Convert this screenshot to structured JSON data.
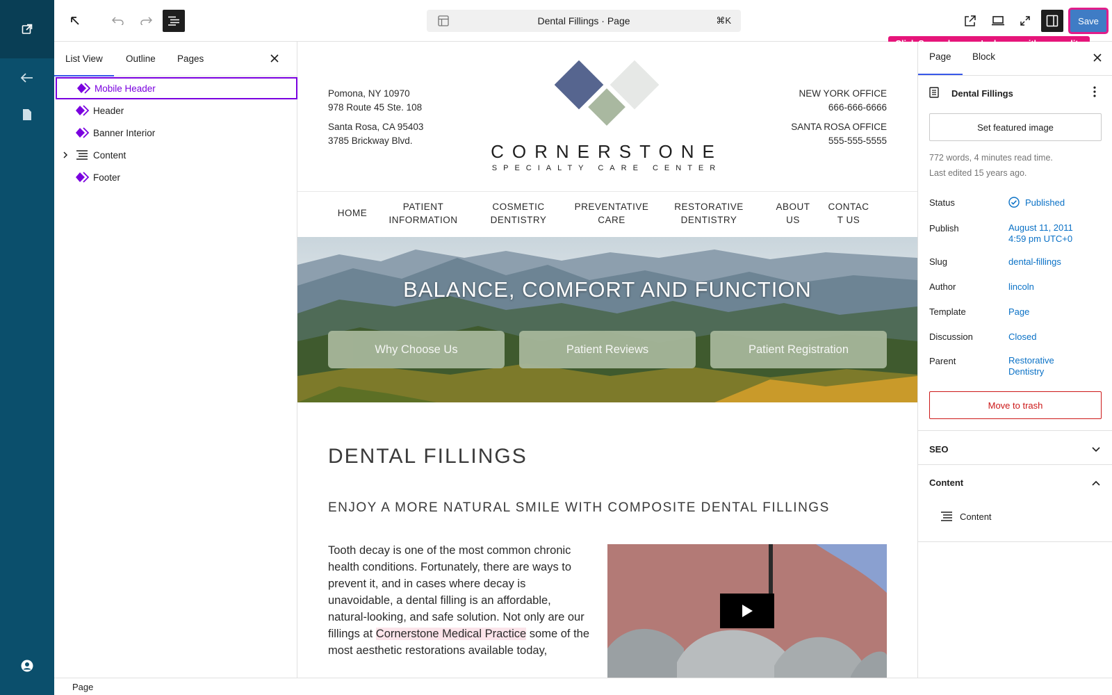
{
  "rail": {
    "icons": [
      "external-link-icon",
      "arrow-left-icon",
      "page-icon",
      "user-avatar-icon"
    ]
  },
  "topbar": {
    "document_title": "Dental Fillings · Page",
    "shortcut": "⌘K",
    "save_label": "Save",
    "tooltip": "Click Save when you're happy with your edits"
  },
  "listview": {
    "tabs": [
      "List View",
      "Outline",
      "Pages"
    ],
    "items": [
      {
        "label": "Mobile Header",
        "selected": true
      },
      {
        "label": "Header"
      },
      {
        "label": "Banner Interior"
      },
      {
        "label": "Content"
      },
      {
        "label": "Footer"
      }
    ]
  },
  "canvas": {
    "header_left": {
      "line1": "Pomona, NY 10970",
      "line2": "978 Route 45 Ste. 108",
      "line3": "Santa Rosa, CA 95403",
      "line4": "3785 Brickway Blvd."
    },
    "logo": {
      "name": "CORNERSTONE",
      "subtitle": "SPECIALTY CARE CENTER",
      "colors": {
        "dark": "#56658f",
        "light": "#e6e8e6",
        "green": "#a9b8a0"
      }
    },
    "header_right": {
      "line1": "NEW YORK OFFICE",
      "line2": "666-666-6666",
      "line3": "SANTA ROSA OFFICE",
      "line4": "555-555-5555"
    },
    "nav": [
      {
        "l1": "HOME",
        "l2": ""
      },
      {
        "l1": "PATIENT",
        "l2": "INFORMATION"
      },
      {
        "l1": "COSMETIC",
        "l2": "DENTISTRY"
      },
      {
        "l1": "PREVENTATIVE",
        "l2": "CARE"
      },
      {
        "l1": "RESTORATIVE",
        "l2": "DENTISTRY"
      },
      {
        "l1": "ABOUT",
        "l2": "US"
      },
      {
        "l1": "CONTAC",
        "l2": "T US"
      }
    ],
    "banner": {
      "title": "BALANCE, COMFORT AND FUNCTION",
      "buttons": [
        "Why Choose Us",
        "Patient Reviews",
        "Patient Registration"
      ]
    },
    "heading": "DENTAL FILLINGS",
    "subheading": "ENJOY A MORE NATURAL SMILE WITH COMPOSITE DENTAL FILLINGS",
    "body": {
      "before": "Tooth decay is one of the most common chronic health conditions. Fortunately, there are ways to prevent it, and in cases where decay is unavoidable, a dental filling is an affordable, natural-looking, and safe solution. Not only are our fillings at ",
      "highlight": "Cornerstone Medical Practice",
      "after": " some of the most aesthetic restorations available today,"
    }
  },
  "sidebar": {
    "tabs": [
      "Page",
      "Block"
    ],
    "doc_title": "Dental Fillings",
    "featured_image_label": "Set featured image",
    "meta_line1": "772 words, 4 minutes read time.",
    "meta_line2": "Last edited 15 years ago.",
    "rows": {
      "status_label": "Status",
      "status_value": "Published",
      "publish_label": "Publish",
      "publish_value1": "August 11, 2011",
      "publish_value2": "4:59 pm UTC+0",
      "slug_label": "Slug",
      "slug_value": "dental-fillings",
      "author_label": "Author",
      "author_value": "lincoln",
      "template_label": "Template",
      "template_value": "Page",
      "discussion_label": "Discussion",
      "discussion_value": "Closed",
      "parent_label": "Parent",
      "parent_value1": "Restorative",
      "parent_value2": "Dentistry"
    },
    "trash_label": "Move to trash",
    "seo_label": "SEO",
    "content_section_label": "Content",
    "content_item_label": "Content"
  },
  "statusbar": {
    "label": "Page"
  }
}
